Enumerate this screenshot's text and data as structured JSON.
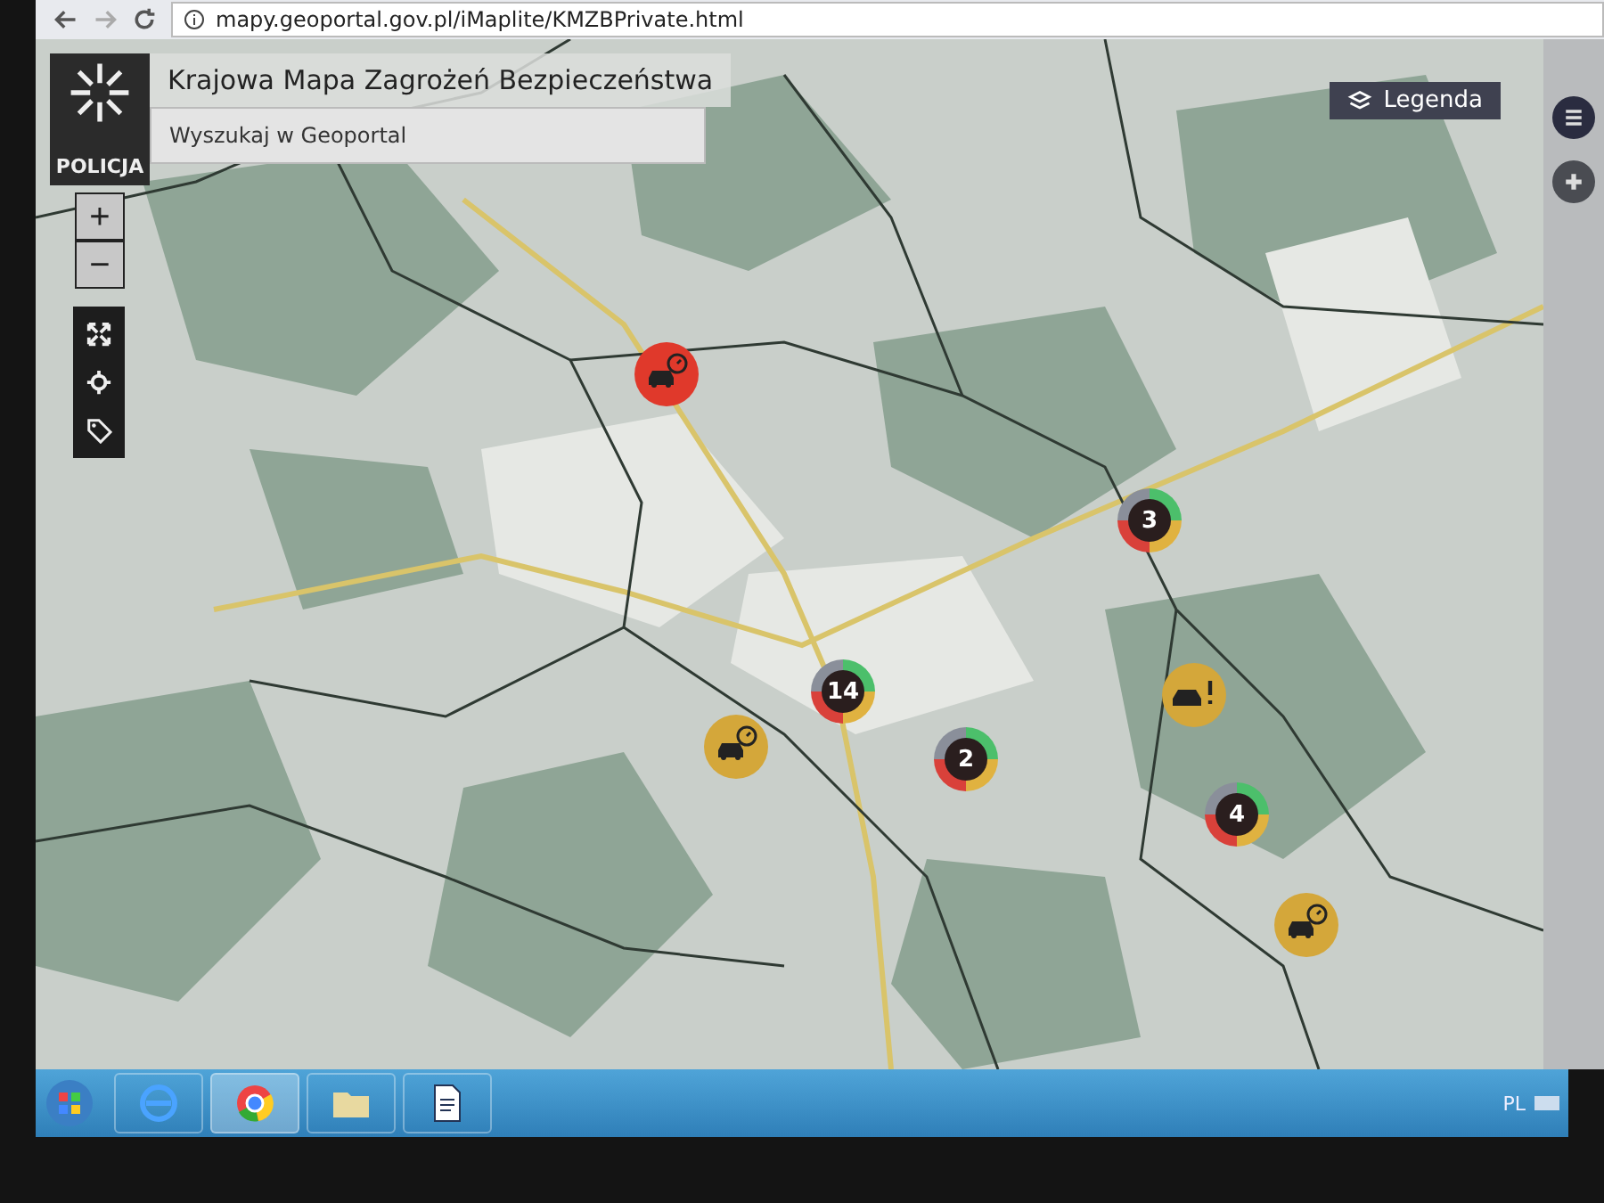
{
  "browser": {
    "url": "mapy.geoportal.gov.pl/iMaplite/KMZBPrivate.html"
  },
  "header": {
    "logo_text": "POLICJA",
    "title": "Krajowa Mapa Zagrożeń Bezpieczeństwa",
    "search": {
      "placeholder": "Wyszukaj w Geoportal"
    }
  },
  "zoom_controls": [
    "+",
    "−"
  ],
  "legend_button": {
    "label": "Legenda"
  },
  "markers": [
    {
      "kind": "event",
      "color": "#e0392b"
    },
    {
      "kind": "cluster",
      "count": "14"
    },
    {
      "kind": "event",
      "color": "#d4a73a"
    },
    {
      "kind": "cluster",
      "count": "2"
    },
    {
      "kind": "cluster",
      "count": "3"
    },
    {
      "kind": "warning",
      "color": "#d4a73a"
    },
    {
      "kind": "cluster",
      "count": "4"
    },
    {
      "kind": "event",
      "color": "#d4a73a"
    }
  ],
  "taskbar": {
    "language": "PL"
  }
}
